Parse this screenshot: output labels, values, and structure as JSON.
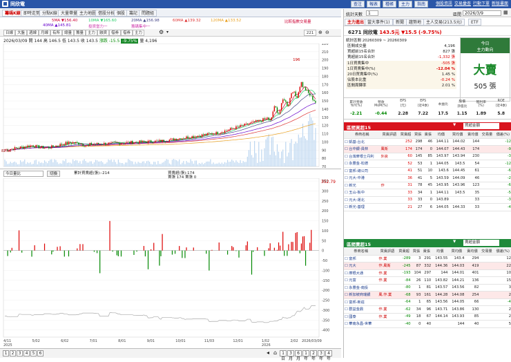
{
  "titlebar": {
    "title": "同欣電",
    "buttons": [
      "查注",
      "報表",
      "種帳",
      "主力",
      "指南"
    ],
    "links": [
      "個股資訊",
      "交易彙查",
      "行動下單",
      "新版畫面"
    ]
  },
  "tabs": [
    "籌碼K線",
    "即時走勢",
    "分點K線",
    "大量帶量",
    "主力地圖",
    "借股分析",
    "個股",
    "籌記",
    "問題組"
  ],
  "legend": {
    "ma5": "5MA ▼156.40",
    "ma10": "10MA ▼165.60",
    "ma20": "20MA ▲156.98",
    "ma60": "60MA ▲139.32",
    "ma120": "120MA ▲133.52",
    "ma40": "40MA ▲145.81",
    "sub1": "投資當力一",
    "sub2": "籌碼集中一",
    "note": "比較指數交易量"
  },
  "toolbar": {
    "items": [
      "日線",
      "大盤",
      "週線",
      "月線",
      "有所",
      "總量",
      "籌量",
      "主力",
      "融資",
      "借券",
      "借券",
      "主力",
      "主力",
      "主力"
    ],
    "zoom": "221"
  },
  "quote": {
    "date": "2026/03/09",
    "open_label": "開 144",
    "high": "高 146.5",
    "low": "低 143.5",
    "close": "收 143.5",
    "chg": "漲跌 -15.5",
    "pct": "-9.75%",
    "vol": "量 4,196"
  },
  "price_chart": {
    "peak_label": "196",
    "low_label": "82.10",
    "yticks": [
      "220",
      "210",
      "200",
      "190",
      "180",
      "170",
      "160",
      "150",
      "140",
      "130",
      "120",
      "110",
      "100",
      "90",
      "80",
      "70"
    ]
  },
  "sub_panel": {
    "select": "今日量比",
    "btn": "切換",
    "legend1": "累計買賣超(張):-214",
    "legend2": "買賣超(張):174",
    "legend3": "賣張 174  賣張 0",
    "max_label": "352.79",
    "yticks": [
      "350",
      "300",
      "250",
      "200",
      "150",
      "100",
      "50",
      "0",
      "-50",
      "-100",
      "-150",
      "-200",
      "-250",
      "-300",
      "-350",
      "-400",
      "-450"
    ]
  },
  "xaxis": {
    "ticks": [
      "4/11\n2025",
      "5/02",
      "6/02",
      "7/01",
      "8/01",
      "9/01",
      "10/01",
      "11/03",
      "12/01",
      "1/02\n2026",
      "2/02",
      "2026/03/09"
    ]
  },
  "pager": {
    "pages": [
      "1",
      "2",
      "3",
      "4",
      "5",
      "6"
    ],
    "ranges": [
      "1日",
      "3月",
      "6月",
      "1年",
      "2年",
      "3年",
      "4年"
    ]
  },
  "right": {
    "stat_label": "統計天數",
    "stat_val": "1",
    "range_label": "區間",
    "range_val": "2026/3/9",
    "tabs": [
      "主力進出",
      "當大事件(1)",
      "新聞",
      "趨勢地",
      "主人交易(213.5元)",
      "ETF"
    ],
    "stock": {
      "name": "6271 同欣電",
      "price": "143.5元",
      "chg": "▼15.5 (-9.75%)"
    },
    "period": "統計區間 20260309 ~ 20260309",
    "stats": [
      [
        "區間成交量",
        "4,196"
      ],
      [
        "買超前15名合計",
        "827 張"
      ],
      [
        "賣超前15名合計",
        "-1,332 張"
      ],
      [
        "1日買賣集中",
        "-505 張"
      ],
      [
        "1日買賣集中(%)",
        "-12.04 %"
      ],
      [
        "20日買賣集中(%)",
        "1.45 %"
      ],
      [
        "佔股本比重",
        "-0.24 %"
      ],
      [
        "區間周轉率",
        "2.01 %"
      ]
    ],
    "today": {
      "title": "今日",
      "sub": "主力動向",
      "action": "大賣",
      "amount": "505 張"
    },
    "fund": {
      "heads": [
        "累計營收\nYoY(%)",
        "營收\nMoM(%)",
        "EPS\n(元)",
        "EPS\n(近4季)",
        "本益比",
        "股價\n淨值比",
        "殖利率\n(%)",
        "ROE\n(近4季)"
      ],
      "vals": [
        "-2.21",
        "-0.44",
        "2.28",
        "7.22",
        "17.5",
        "1.15",
        "1.89",
        "5.8"
      ]
    },
    "buy": {
      "title": "區間買超15",
      "select": "買超金額",
      "heads": [
        "券商名稱",
        "買賣評語",
        "買賣超",
        "買張",
        "賣張",
        "均價",
        "買均價",
        "賣均價",
        "交易量",
        "價差(%)"
      ],
      "rows": [
        [
          "凱基-台北",
          "",
          "252",
          "298",
          "46",
          "144.11",
          "144.02",
          "144",
          "",
          "-12"
        ],
        [
          "台中銀-員林",
          "風衛",
          "174",
          "174",
          "0",
          "144.07",
          "144.43",
          "174",
          "",
          "-9"
        ],
        [
          "台灣摩根士丹利",
          "外資",
          "60",
          "145",
          "85",
          "143.97",
          "143.94",
          "230",
          "",
          "-3"
        ],
        [
          "永豐金-松德",
          "",
          "52",
          "53",
          "1",
          "144.05",
          "143.5",
          "54",
          "",
          "-12"
        ],
        [
          "富邦-總公司",
          "",
          "41",
          "51",
          "10",
          "143.6",
          "144.45",
          "61",
          "",
          "-6"
        ],
        [
          "元大-中港",
          "",
          "36",
          "41",
          "5",
          "143.59",
          "144.09",
          "46",
          "",
          "-2"
        ],
        [
          "新光",
          "作",
          "31",
          "78",
          "45",
          "143.95",
          "143.96",
          "123",
          "",
          "-6"
        ],
        [
          "玉山-板中",
          "",
          "33",
          "34",
          "1",
          "144.11",
          "143.5",
          "35",
          "",
          "-5"
        ],
        [
          "元大-運北",
          "",
          "33",
          "33",
          "0",
          "143.89",
          "",
          "33",
          "",
          "-3"
        ],
        [
          "新光-基理",
          "",
          "21",
          "27",
          "6",
          "144.05",
          "144.33",
          "33",
          "",
          "-4"
        ]
      ]
    },
    "sell": {
      "title": "區間賣超15",
      "select": "賣超金額",
      "heads": [
        "券商名稱",
        "買賣評語",
        "買賣超",
        "買張",
        "賣張",
        "均價",
        "買均價",
        "賣均價",
        "交易量",
        "價差(%)"
      ],
      "rows": [
        [
          "富邦",
          "作.業",
          "-289",
          "3",
          "291",
          "143.55",
          "143.4",
          "294",
          "",
          "12"
        ],
        [
          "元大",
          "作.風衛",
          "-245",
          "87",
          "332",
          "144.36",
          "144.03",
          "419",
          "",
          "22"
        ],
        [
          "摩根大通",
          "作.業",
          "-193",
          "104",
          "297",
          "144",
          "144.01",
          "401",
          "",
          "10"
        ],
        [
          "元富",
          "作.業",
          "-84",
          "26",
          "110",
          "143.82",
          "144.21",
          "136",
          "",
          "15"
        ],
        [
          "永豐金-南投",
          "",
          "-80",
          "1",
          "81",
          "143.57",
          "143.56",
          "82",
          "",
          "3"
        ],
        [
          "新加坡商瑞銀",
          "風.作.業",
          "-68",
          "93",
          "161",
          "144.28",
          "144.08",
          "254",
          "",
          "2"
        ],
        [
          "富邦-新莊",
          "",
          "-64",
          "1",
          "65",
          "143.56",
          "144.05",
          "66",
          "",
          "-4"
        ],
        [
          "群益金鼎",
          "作.業",
          "-62",
          "34",
          "96",
          "143.71",
          "143.86",
          "130",
          "",
          "2"
        ],
        [
          "國泰",
          "作.業",
          "-49",
          "18",
          "67",
          "144.14",
          "143.93",
          "85",
          "",
          "2"
        ],
        [
          "華南永昌-世華",
          "",
          "-40",
          "0",
          "40",
          "",
          "144",
          "40",
          "",
          "5"
        ]
      ]
    }
  },
  "colors": {
    "up": "#d00000",
    "down": "#008000",
    "accent": "#2a56a8",
    "sell_badge": "#d8141e",
    "buy_badge": "#1f8a3a"
  }
}
